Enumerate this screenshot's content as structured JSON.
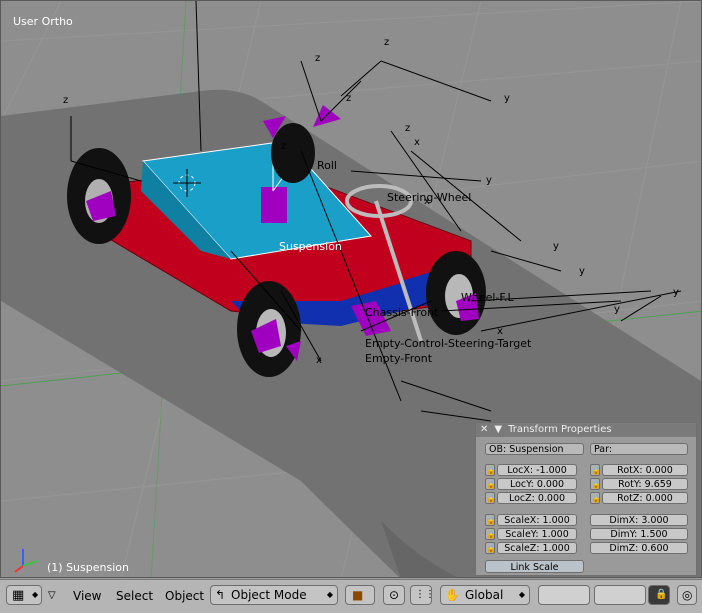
{
  "viewport": {
    "view_name": "User Ortho",
    "status_text": "(1) Suspension",
    "object_labels": [
      "Suspension",
      "Steering-Wheel",
      "Wheel-F.L",
      "Empty-Control-Steering-Target",
      "Empty-Front",
      "Chassis-Front",
      "Roll"
    ],
    "axis_letters": {
      "x": "x",
      "y": "y",
      "z": "z"
    }
  },
  "transform_panel": {
    "title": "Transform Properties",
    "ob_field": "OB: Suspension",
    "par_field": "Par:",
    "loc": {
      "x": "LocX: -1.000",
      "y": "LocY: 0.000",
      "z": "LocZ: 0.000"
    },
    "rot": {
      "x": "RotX: 0.000",
      "y": "RotY: 9.659",
      "z": "RotZ: 0.000"
    },
    "scale": {
      "x": "ScaleX: 1.000",
      "y": "ScaleY: 1.000",
      "z": "ScaleZ: 1.000"
    },
    "dim": {
      "x": "DimX: 3.000",
      "y": "DimY: 1.500",
      "z": "DimZ: 0.600"
    },
    "link_scale_label": "Link Scale"
  },
  "header": {
    "menu_view": "View",
    "menu_select": "Select",
    "menu_object": "Object",
    "mode": "Object Mode",
    "orientation": "Global"
  },
  "colors": {
    "chassis_red": "#c0001c",
    "body_cyan": "#1aa0c8",
    "magenta": "#a000c0",
    "ground": "#707070",
    "viewport_bg": "#8e8e8e"
  }
}
